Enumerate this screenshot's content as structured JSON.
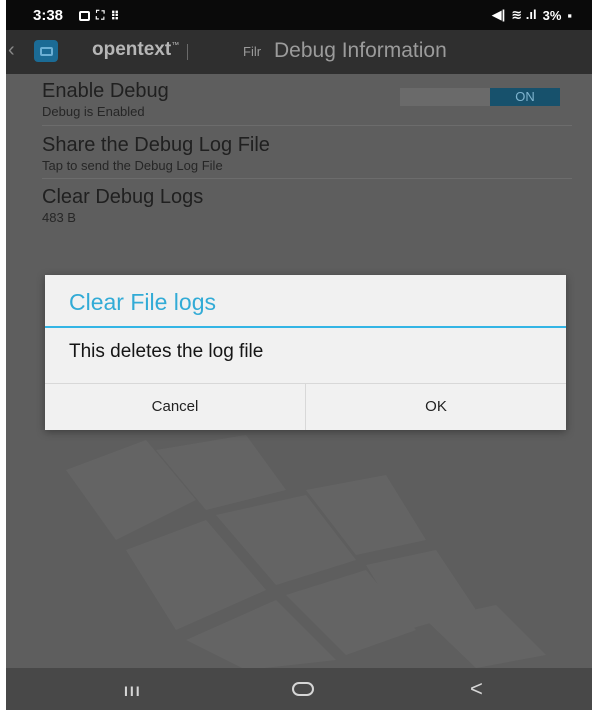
{
  "status_bar": {
    "time": "3:38",
    "icons": [
      "notification-icon",
      "gallery-icon",
      "more-notifications-icon"
    ],
    "mute_glyph": "◀|",
    "signal_glyph": "≋ .ıl",
    "battery": "3%"
  },
  "action_bar": {
    "back_glyph": "‹",
    "brand": "opentext",
    "brand_mark": "™",
    "product": "Filr",
    "title": "Debug Information"
  },
  "settings": [
    {
      "title": "Enable Debug",
      "subtitle": "Debug is Enabled"
    },
    {
      "title": "Share the Debug Log File",
      "subtitle": "Tap to send the Debug Log File"
    },
    {
      "title": "Clear Debug Logs",
      "subtitle": "483 B"
    }
  ],
  "toggle": {
    "label": "ON",
    "state": "on"
  },
  "dialog": {
    "title": "Clear File logs",
    "message": "This deletes the log file",
    "cancel_label": "Cancel",
    "ok_label": "OK"
  },
  "nav_bar": {
    "recent_glyph": "III",
    "back_glyph": "<"
  },
  "colors": {
    "accent": "#33b5e5",
    "toggle_on": "#17516c",
    "status_bar": "#0a0a0a",
    "dim_background": "#5e5e5e"
  }
}
